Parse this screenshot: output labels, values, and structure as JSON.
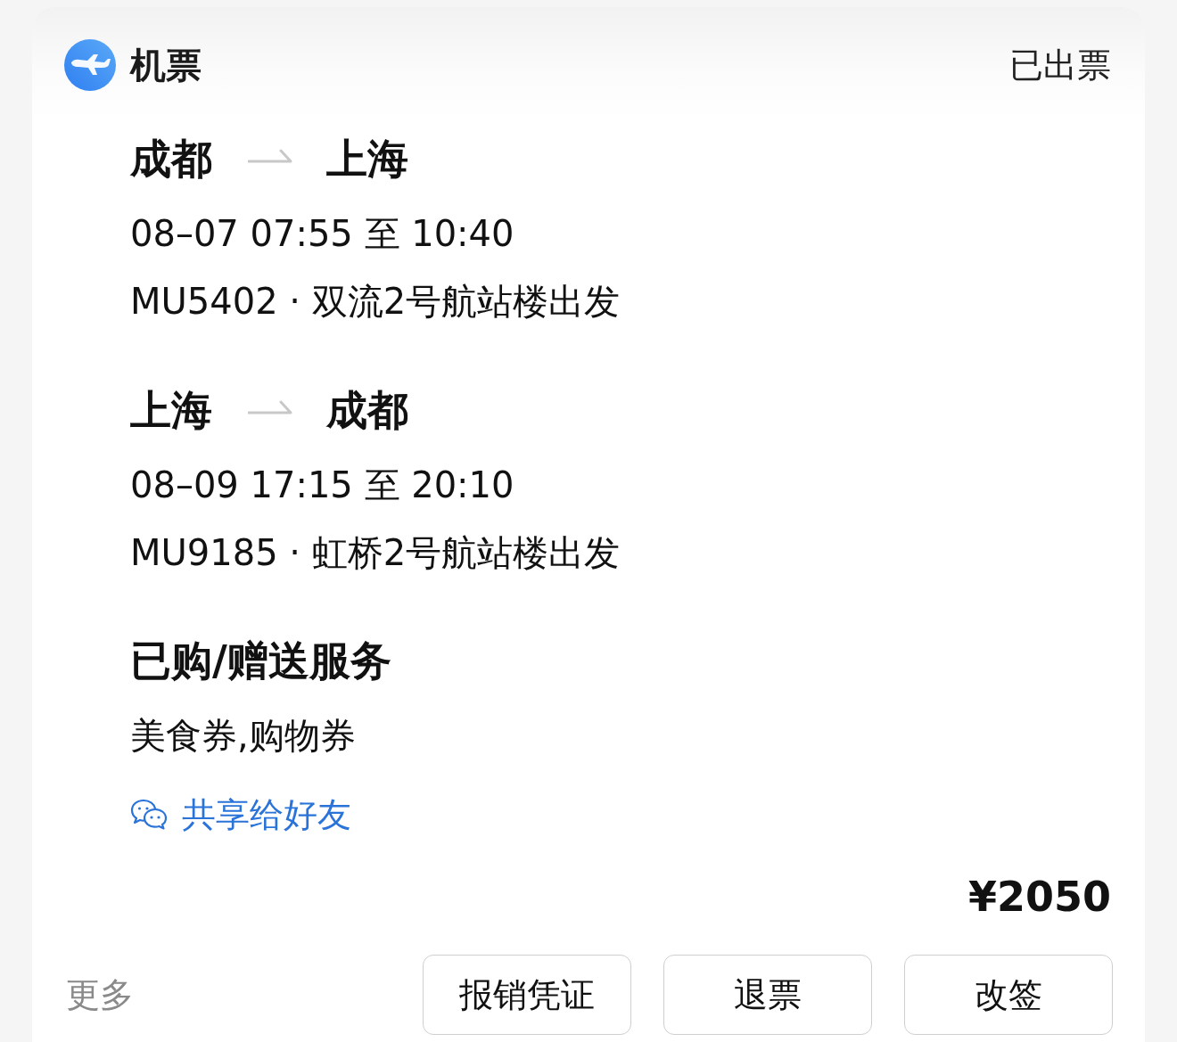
{
  "header": {
    "title": "机票",
    "status": "已出票"
  },
  "segments": [
    {
      "from": "成都",
      "to": "上海",
      "time": "08–07 07:55 至 10:40",
      "flight": "MU5402 · 双流2号航站楼出发"
    },
    {
      "from": "上海",
      "to": "成都",
      "time": "08–09 17:15 至 20:10",
      "flight": "MU9185 · 虹桥2号航站楼出发"
    }
  ],
  "services": {
    "title": "已购/赠送服务",
    "items": "美食券,购物券"
  },
  "share": {
    "label": "共享给好友"
  },
  "price": "¥2050",
  "footer": {
    "more": "更多",
    "buttons": [
      "报销凭证",
      "退票",
      "改签"
    ]
  }
}
